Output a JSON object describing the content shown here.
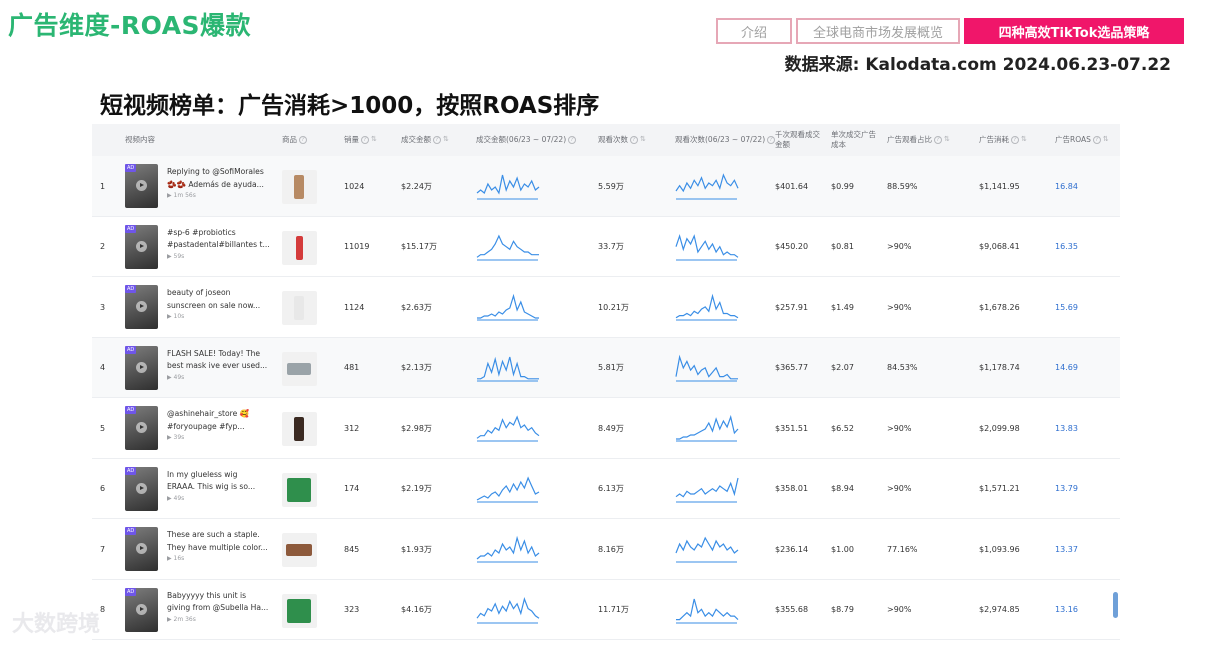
{
  "slide": {
    "title": "广告维度-ROAS爆款",
    "subtitle": "短视频榜单：广告消耗>1000，按照ROAS排序",
    "source": "数据来源: Kalodata.com 2024.06.23-07.22",
    "watermark": "大数跨境"
  },
  "tabs": [
    {
      "label": "介绍",
      "active": false
    },
    {
      "label": "全球电商市场发展概览",
      "active": false
    },
    {
      "label": "四种高效TikTok选品策略",
      "active": true
    }
  ],
  "colors": {
    "title_green": "#2bb673",
    "active_tab": "#f0166a",
    "spark_blue": "#3a8ee6",
    "roas_blue": "#2f6fcf"
  },
  "table": {
    "columns": [
      "视频内容",
      "商品",
      "销量",
      "成交金额",
      "成交金额(06/23 ~ 07/22)",
      "观看次数",
      "观看次数(06/23 ~ 07/22)",
      "千次观看成交金额",
      "单次成交广告成本",
      "广告观看占比",
      "广告消耗",
      "广告ROAS"
    ],
    "rows": [
      {
        "rank": "1",
        "text1": "Replying to @SofiMorales",
        "text2": "🫘🫘 Además de ayuda...",
        "duration": "▶ 1m 56s",
        "sales": "1024",
        "gmv": "$2.24万",
        "gmv_trend": [
          2,
          3,
          2,
          5,
          3,
          4,
          2,
          8,
          3,
          6,
          4,
          7,
          3,
          5,
          4,
          6,
          3,
          4
        ],
        "views": "5.59万",
        "views_trend": [
          3,
          5,
          3,
          6,
          4,
          7,
          5,
          8,
          4,
          6,
          5,
          7,
          4,
          9,
          6,
          5,
          7,
          4
        ],
        "gpm": "$401.64",
        "cpa": "$0.99",
        "ad_ratio": "88.59%",
        "ad_spend": "$1,141.95",
        "roas": "16.84"
      },
      {
        "rank": "2",
        "text1": "#sp-6 #probiotics",
        "text2": "#pastadental#billantes t...",
        "duration": "▶ 59s",
        "sales": "11019",
        "gmv": "$15.17万",
        "gmv_trend": [
          1,
          2,
          2,
          3,
          4,
          6,
          9,
          6,
          5,
          4,
          7,
          5,
          4,
          3,
          3,
          2,
          2,
          2
        ],
        "views": "33.7万",
        "views_trend": [
          5,
          9,
          4,
          8,
          6,
          9,
          3,
          5,
          7,
          4,
          6,
          3,
          5,
          2,
          3,
          2,
          2,
          1
        ],
        "gpm": "$450.20",
        "cpa": "$0.81",
        "ad_ratio": ">90%",
        "ad_spend": "$9,068.41",
        "roas": "16.35"
      },
      {
        "rank": "3",
        "text1": "beauty of joseon",
        "text2": "sunscreen on sale now...",
        "duration": "▶ 10s",
        "sales": "1124",
        "gmv": "$2.63万",
        "gmv_trend": [
          1,
          1,
          2,
          2,
          3,
          2,
          4,
          3,
          5,
          6,
          12,
          5,
          9,
          4,
          3,
          2,
          1,
          1
        ],
        "views": "10.21万",
        "views_trend": [
          1,
          2,
          2,
          3,
          2,
          4,
          3,
          5,
          6,
          4,
          11,
          5,
          8,
          3,
          3,
          2,
          2,
          1
        ],
        "gpm": "$257.91",
        "cpa": "$1.49",
        "ad_ratio": ">90%",
        "ad_spend": "$1,678.26",
        "roas": "15.69"
      },
      {
        "rank": "4",
        "text1": "FLASH SALE! Today! The",
        "text2": "best mask ive ever used...",
        "duration": "▶ 49s",
        "sales": "481",
        "gmv": "$2.13万",
        "gmv_trend": [
          1,
          1,
          2,
          8,
          4,
          10,
          3,
          9,
          5,
          11,
          3,
          8,
          2,
          2,
          1,
          1,
          1,
          1
        ],
        "views": "5.81万",
        "views_trend": [
          2,
          11,
          6,
          9,
          5,
          7,
          3,
          5,
          6,
          2,
          4,
          6,
          2,
          2,
          3,
          1,
          1,
          1
        ],
        "gpm": "$365.77",
        "cpa": "$2.07",
        "ad_ratio": "84.53%",
        "ad_spend": "$1,178.74",
        "roas": "14.69"
      },
      {
        "rank": "5",
        "text1": "@ashinehair_store 🥰",
        "text2": "#foryoupage #fyp...",
        "duration": "▶ 39s",
        "sales": "312",
        "gmv": "$2.98万",
        "gmv_trend": [
          1,
          2,
          2,
          4,
          3,
          5,
          4,
          8,
          5,
          7,
          6,
          9,
          5,
          6,
          4,
          5,
          3,
          2
        ],
        "views": "8.49万",
        "views_trend": [
          1,
          1,
          2,
          2,
          3,
          3,
          4,
          5,
          6,
          9,
          5,
          11,
          6,
          10,
          7,
          12,
          4,
          6
        ],
        "gpm": "$351.51",
        "cpa": "$6.52",
        "ad_ratio": ">90%",
        "ad_spend": "$2,099.98",
        "roas": "13.83"
      },
      {
        "rank": "6",
        "text1": "In my glueless wig",
        "text2": "ERAAA. This wig is so...",
        "duration": "▶ 49s",
        "sales": "174",
        "gmv": "$2.19万",
        "gmv_trend": [
          1,
          2,
          3,
          2,
          4,
          5,
          3,
          6,
          8,
          5,
          9,
          6,
          10,
          7,
          12,
          8,
          4,
          5
        ],
        "views": "6.13万",
        "views_trend": [
          2,
          3,
          2,
          4,
          3,
          3,
          4,
          5,
          3,
          4,
          5,
          4,
          6,
          5,
          4,
          7,
          3,
          9
        ],
        "gpm": "$358.01",
        "cpa": "$8.94",
        "ad_ratio": ">90%",
        "ad_spend": "$1,571.21",
        "roas": "13.79"
      },
      {
        "rank": "7",
        "text1": "These are such a staple.",
        "text2": "They have multiple color...",
        "duration": "▶ 16s",
        "sales": "845",
        "gmv": "$1.93万",
        "gmv_trend": [
          1,
          2,
          2,
          3,
          2,
          4,
          3,
          6,
          4,
          5,
          3,
          8,
          4,
          7,
          3,
          5,
          2,
          3
        ],
        "views": "8.16万",
        "views_trend": [
          3,
          6,
          4,
          7,
          5,
          4,
          6,
          5,
          8,
          6,
          4,
          7,
          5,
          6,
          4,
          5,
          3,
          4
        ],
        "gpm": "$236.14",
        "cpa": "$1.00",
        "ad_ratio": "77.16%",
        "ad_spend": "$1,093.96",
        "roas": "13.37"
      },
      {
        "rank": "8",
        "text1": "Babyyyyy this unit is",
        "text2": "giving from @Subella Ha...",
        "duration": "▶ 2m 36s",
        "sales": "323",
        "gmv": "$4.16万",
        "gmv_trend": [
          2,
          4,
          3,
          6,
          5,
          8,
          4,
          7,
          5,
          9,
          6,
          8,
          4,
          10,
          6,
          5,
          3,
          2
        ],
        "views": "11.71万",
        "views_trend": [
          1,
          1,
          2,
          3,
          2,
          7,
          3,
          4,
          2,
          3,
          2,
          4,
          3,
          2,
          3,
          2,
          2,
          1
        ],
        "gpm": "$355.68",
        "cpa": "$8.79",
        "ad_ratio": ">90%",
        "ad_spend": "$2,974.85",
        "roas": "13.16"
      }
    ]
  }
}
